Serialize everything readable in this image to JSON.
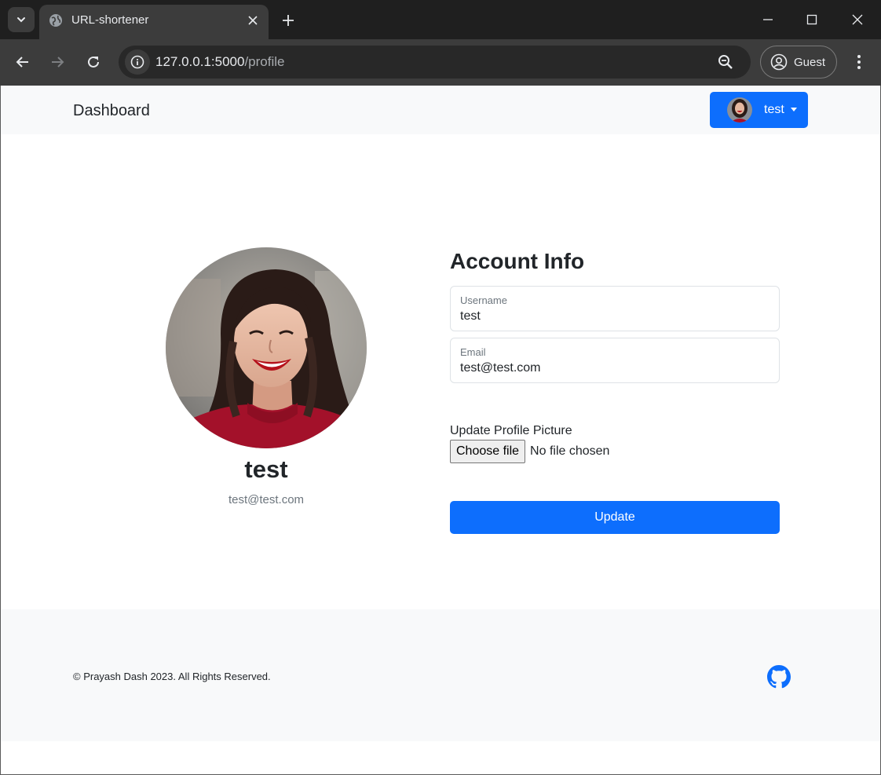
{
  "browser": {
    "tab_title": "URL-shortener",
    "url_host": "127.0.0.1:5000",
    "url_path": "/profile",
    "profile_label": "Guest"
  },
  "navbar": {
    "brand": "Dashboard",
    "user_name": "test"
  },
  "profile": {
    "name": "test",
    "email": "test@test.com"
  },
  "form": {
    "title": "Account Info",
    "username_label": "Username",
    "username_value": "test",
    "email_label": "Email",
    "email_value": "test@test.com",
    "file_label": "Update Profile Picture",
    "file_button": "Choose file",
    "file_status": "No file chosen",
    "submit_label": "Update"
  },
  "footer": {
    "copyright": "© Prayash Dash 2023. All Rights Reserved.",
    "github_icon": "github-icon"
  },
  "colors": {
    "primary": "#0d6efd",
    "light_bg": "#f8f9fa"
  }
}
